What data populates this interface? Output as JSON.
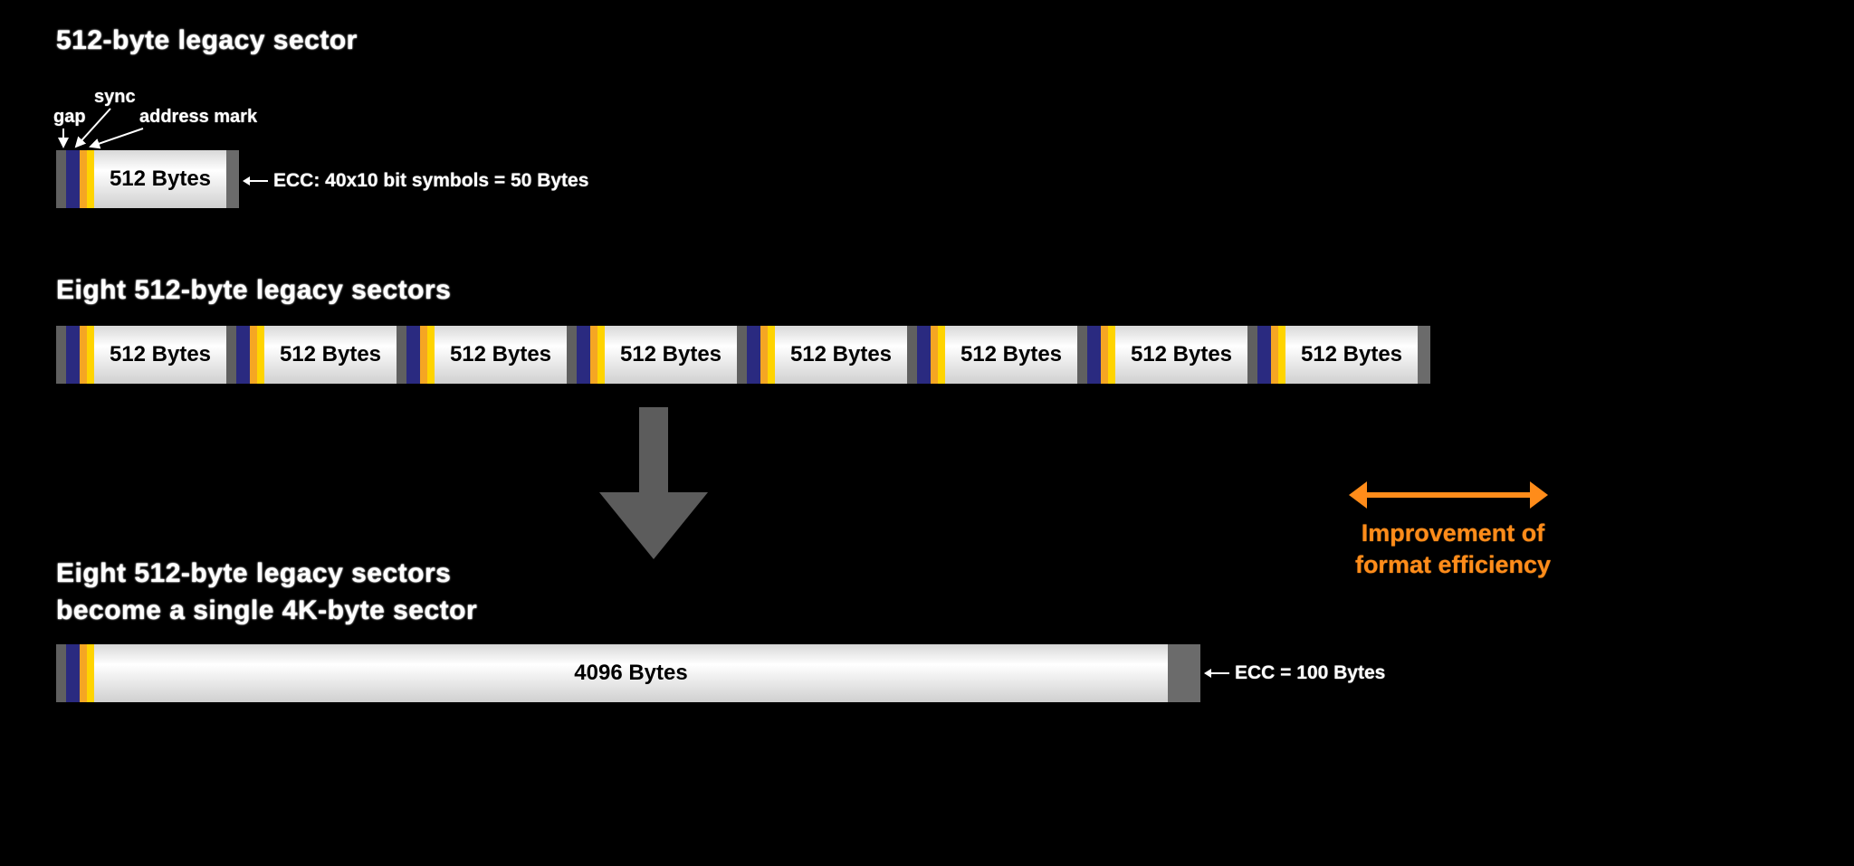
{
  "section1": {
    "title": "512-byte legacy sector",
    "labels": {
      "gap": "gap",
      "sync": "sync",
      "address_mark": "address mark"
    },
    "data_label": "512 Bytes",
    "ecc_label": "ECC: 40x10 bit symbols = 50 Bytes"
  },
  "section2": {
    "title": "Eight 512-byte legacy sectors",
    "data_label": "512 Bytes",
    "count": 8
  },
  "efficiency": {
    "line1": "Improvement of",
    "line2": "format efficiency"
  },
  "section3": {
    "title_line1": "Eight 512-byte legacy sectors",
    "title_line2": "become a single 4K-byte sector",
    "data_label": "4096 Bytes",
    "ecc_label": "ECC = 100 Bytes"
  },
  "colors": {
    "gap": "#606060",
    "sync": "#2a2a80",
    "address_mark": "#ffd400",
    "ecc": "#6b6b6b",
    "accent": "#ff8c1a"
  }
}
